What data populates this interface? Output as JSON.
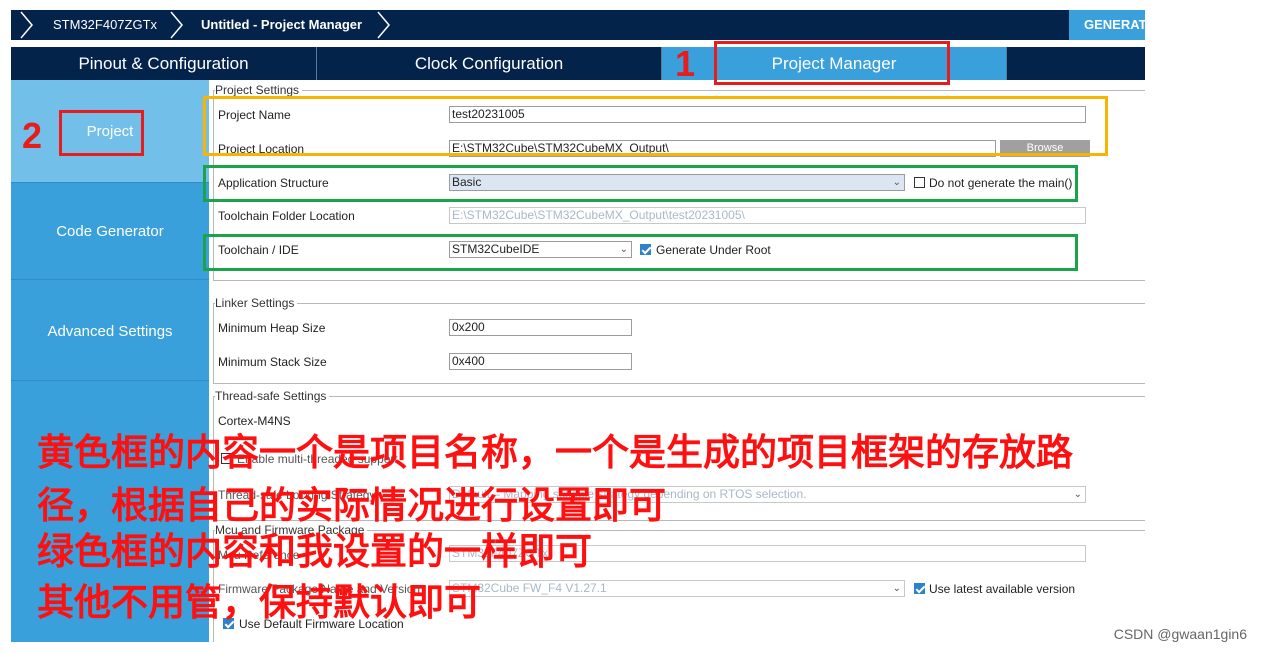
{
  "breadcrumb": {
    "device": "STM32F407ZGTx",
    "current": "Untitled - Project Manager",
    "generate": "GENERATE CODE"
  },
  "tabs": [
    "Pinout & Configuration",
    "Clock Configuration",
    "Project Manager"
  ],
  "sidebar": {
    "items": [
      "Project",
      "Code Generator",
      "Advanced Settings"
    ]
  },
  "project_settings": {
    "title": "Project Settings",
    "project_name_label": "Project Name",
    "project_name": "test20231005",
    "project_location_label": "Project Location",
    "project_location": "E:\\STM32Cube\\STM32CubeMX_Output\\",
    "browse": "Browse",
    "app_structure_label": "Application Structure",
    "app_structure": "Basic",
    "no_main_label": "Do not generate the main()",
    "toolchain_folder_label": "Toolchain Folder Location",
    "toolchain_folder": "E:\\STM32Cube\\STM32CubeMX_Output\\test20231005\\",
    "toolchain_ide_label": "Toolchain / IDE",
    "toolchain_ide": "STM32CubeIDE",
    "generate_under_root": "Generate Under Root"
  },
  "linker_settings": {
    "title": "Linker Settings",
    "heap_label": "Minimum Heap Size",
    "heap": "0x200",
    "stack_label": "Minimum Stack Size",
    "stack": "0x400"
  },
  "thread_settings": {
    "title": "Thread-safe Settings",
    "core": "Cortex-M4NS",
    "enable_label": "Enable multi-threaded support",
    "locking_label": "Thread-safe Locking Strategy",
    "locking_value": "Default – Mapping suitable strategy depending on RTOS selection."
  },
  "mcu_firmware": {
    "title": "Mcu and Firmware Package",
    "mcu_ref_label": "Mcu Reference",
    "mcu_ref": "STM32F407ZGTx",
    "fw_label": "Firmware Package Name and Version",
    "fw_value": "STM32Cube FW_F4 V1.27.1",
    "use_latest": "Use latest available version",
    "use_default_fw": "Use Default Firmware Location"
  },
  "annotations": {
    "num1": "1",
    "num2": "2",
    "note_lines": [
      "黄色框的内容一个是项目名称，一个是生成的项目框架的存放路",
      "径，根据自己的实际情况进行设置即可",
      "绿色框的内容和我设置的一样即可",
      "其他不用管，保持默认即可"
    ]
  },
  "watermark": "CSDN @gwaan1gin6",
  "colors": {
    "nav_dark": "#03234b",
    "accent": "#3aa0db",
    "annot_red": "#e81c1c",
    "annot_yellow": "#f7b400",
    "annot_green": "#19a44a"
  }
}
